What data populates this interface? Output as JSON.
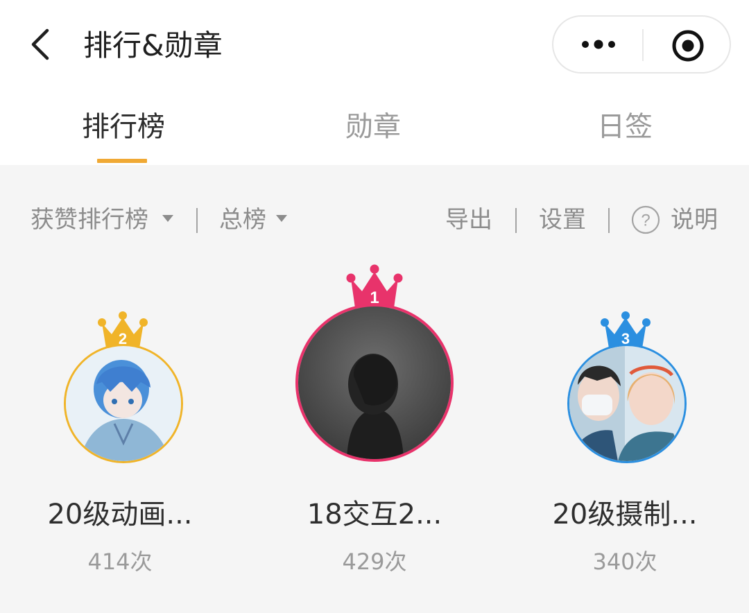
{
  "header": {
    "title": "排行&勋章",
    "back_icon": "chevron-left-icon",
    "capsule_icons": [
      "more-dots-icon",
      "target-icon"
    ]
  },
  "tabs": [
    {
      "label": "排行榜",
      "active": true
    },
    {
      "label": "勋章",
      "active": false
    },
    {
      "label": "日签",
      "active": false
    }
  ],
  "toolbar": {
    "ranking_type": "获赞排行榜",
    "period": "总榜",
    "export": "导出",
    "settings": "设置",
    "help": "说明",
    "help_icon": "question-circle-icon"
  },
  "podium": [
    {
      "rank": "2",
      "name": "20级动画...",
      "count": "414次",
      "color": "#f0b429"
    },
    {
      "rank": "1",
      "name": "18交互2...",
      "count": "429次",
      "color": "#e8336b"
    },
    {
      "rank": "3",
      "name": "20级摄制...",
      "count": "340次",
      "color": "#2b8fe0"
    }
  ],
  "colors": {
    "tab_indicator": "#f0a934",
    "background": "#f5f5f5"
  }
}
